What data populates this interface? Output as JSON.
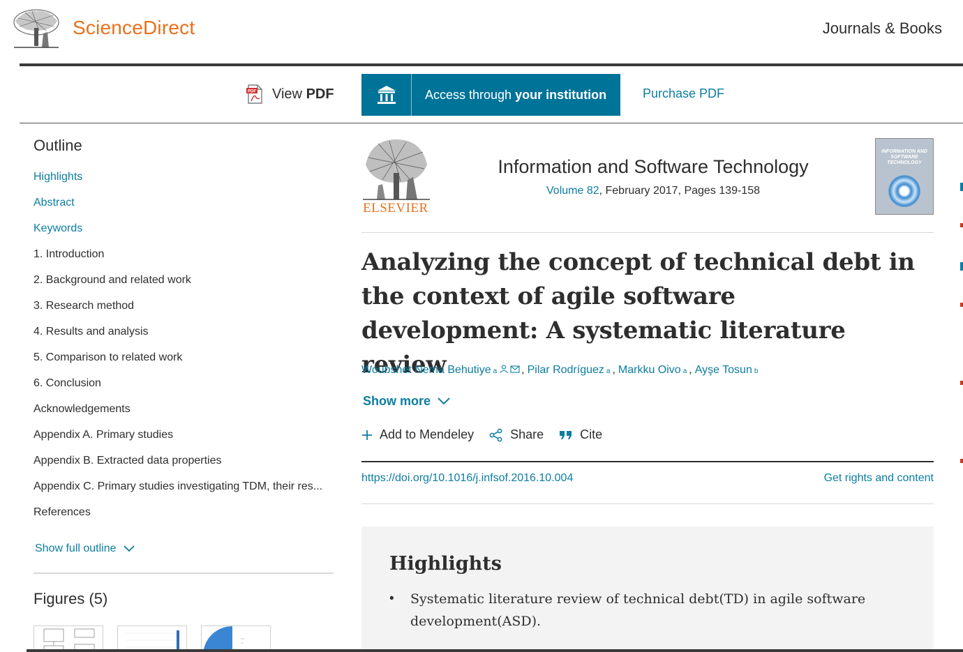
{
  "header": {
    "brand": "ScienceDirect",
    "journals_books": "Journals & Books",
    "colors": {
      "brand": "#e9711c",
      "link": "#0c7da1",
      "accent": "#007398"
    }
  },
  "toolbar": {
    "view_pdf_prefix": "View",
    "view_pdf_bold": "PDF",
    "access_prefix": "Access through",
    "access_bold": "your institution",
    "purchase_pdf": "Purchase PDF",
    "icons": {
      "pdf": "pdf-file-icon",
      "institution": "institution-icon"
    }
  },
  "outline": {
    "title": "Outline",
    "items": [
      {
        "label": "Highlights"
      },
      {
        "label": "Abstract"
      },
      {
        "label": "Keywords"
      },
      {
        "label": "1. Introduction"
      },
      {
        "label": "2. Background and related work"
      },
      {
        "label": "3. Research method"
      },
      {
        "label": "4. Results and analysis"
      },
      {
        "label": "5. Comparison to related work"
      },
      {
        "label": "6. Conclusion"
      },
      {
        "label": "Acknowledgements"
      },
      {
        "label": "Appendix A. Primary studies"
      },
      {
        "label": "Appendix B. Extracted data properties"
      },
      {
        "label": "Appendix C. Primary studies investigating TDM, their res..."
      },
      {
        "label": "References"
      }
    ],
    "show_full_outline": "Show full outline",
    "figures_title": "Figures (5)"
  },
  "journal": {
    "publisher": "ELSEVIER",
    "title": "Information and Software Technology",
    "volume_link": "Volume 82",
    "volume_rest": ", February 2017, Pages 139-158",
    "cover_text": "INFORMATION AND SOFTWARE TECHNOLOGY"
  },
  "article": {
    "title": "Analyzing the concept of technical debt in the context of agile software development: A systematic literature review",
    "authors": [
      {
        "name": "Woubshet Nema Behutiye",
        "affil": "a"
      },
      {
        "name": "Pilar Rodríguez",
        "affil": "a"
      },
      {
        "name": "Markku Oivo",
        "affil": "a"
      },
      {
        "name": "Ayşe Tosun",
        "affil": "b"
      }
    ],
    "author_sep": ",",
    "show_more": "Show more",
    "actions": {
      "mendeley": "Add to Mendeley",
      "share": "Share",
      "cite": "Cite"
    },
    "doi": "https://doi.org/10.1016/j.infsof.2016.10.004",
    "rights": "Get rights and content"
  },
  "highlights": {
    "title": "Highlights",
    "items": [
      "Systematic literature review of technical debt(TD) in agile software development(ASD)."
    ]
  }
}
